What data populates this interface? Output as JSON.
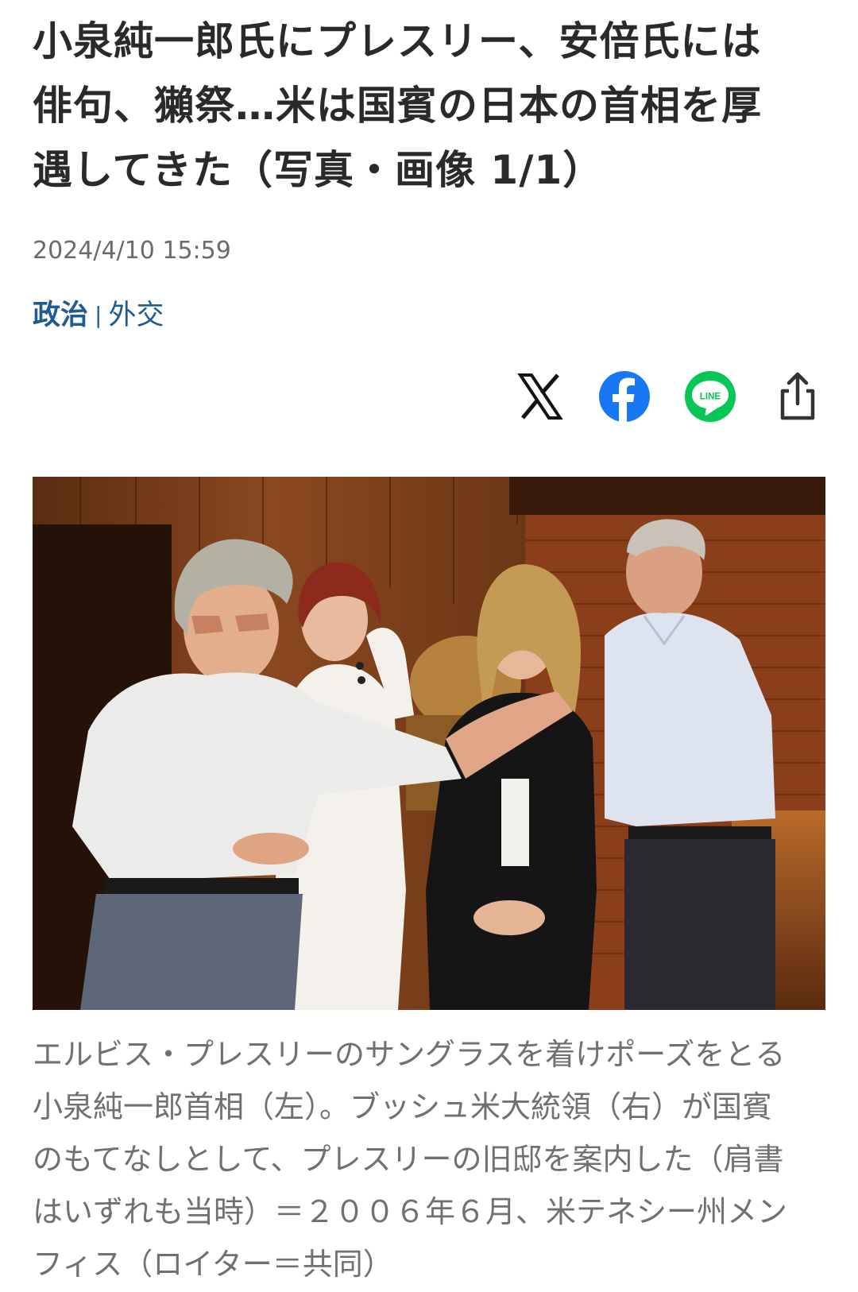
{
  "article": {
    "title_lines": [
      "小泉純一郎氏にプレスリー、安倍氏には",
      "俳句、獺祭…米は国賓の日本の首相を厚",
      "遇してきた（写真・画像 1/1）"
    ],
    "timestamp": "2024/4/10 15:59",
    "category_primary": "政治",
    "category_separator": "|",
    "category_secondary": "外交"
  },
  "share": {
    "x_icon": "x-logo-icon",
    "facebook_icon": "facebook-icon",
    "line_icon": "line-icon",
    "line_text": "LINE",
    "share_icon": "share-upload-icon",
    "colors": {
      "x": "#111111",
      "facebook": "#1877f2",
      "line": "#06c755",
      "share": "#333333"
    }
  },
  "photo": {
    "caption_lines": [
      "エルビス・プレスリーのサングラスを着けポーズをとる",
      "小泉純一郎首相（左）。ブッシュ米大統領（右）が国賓",
      "のもてなしとして、プレスリーの旧邸を案内した（肩書",
      "はいずれも当時）＝２００６年６月、米テネシー州メン",
      "フィス（ロイター＝共同）"
    ]
  },
  "colors": {
    "category_link": "#1f5c8f",
    "timestamp": "#6b6b6b",
    "caption": "#707070",
    "title": "#2a2a2a"
  }
}
